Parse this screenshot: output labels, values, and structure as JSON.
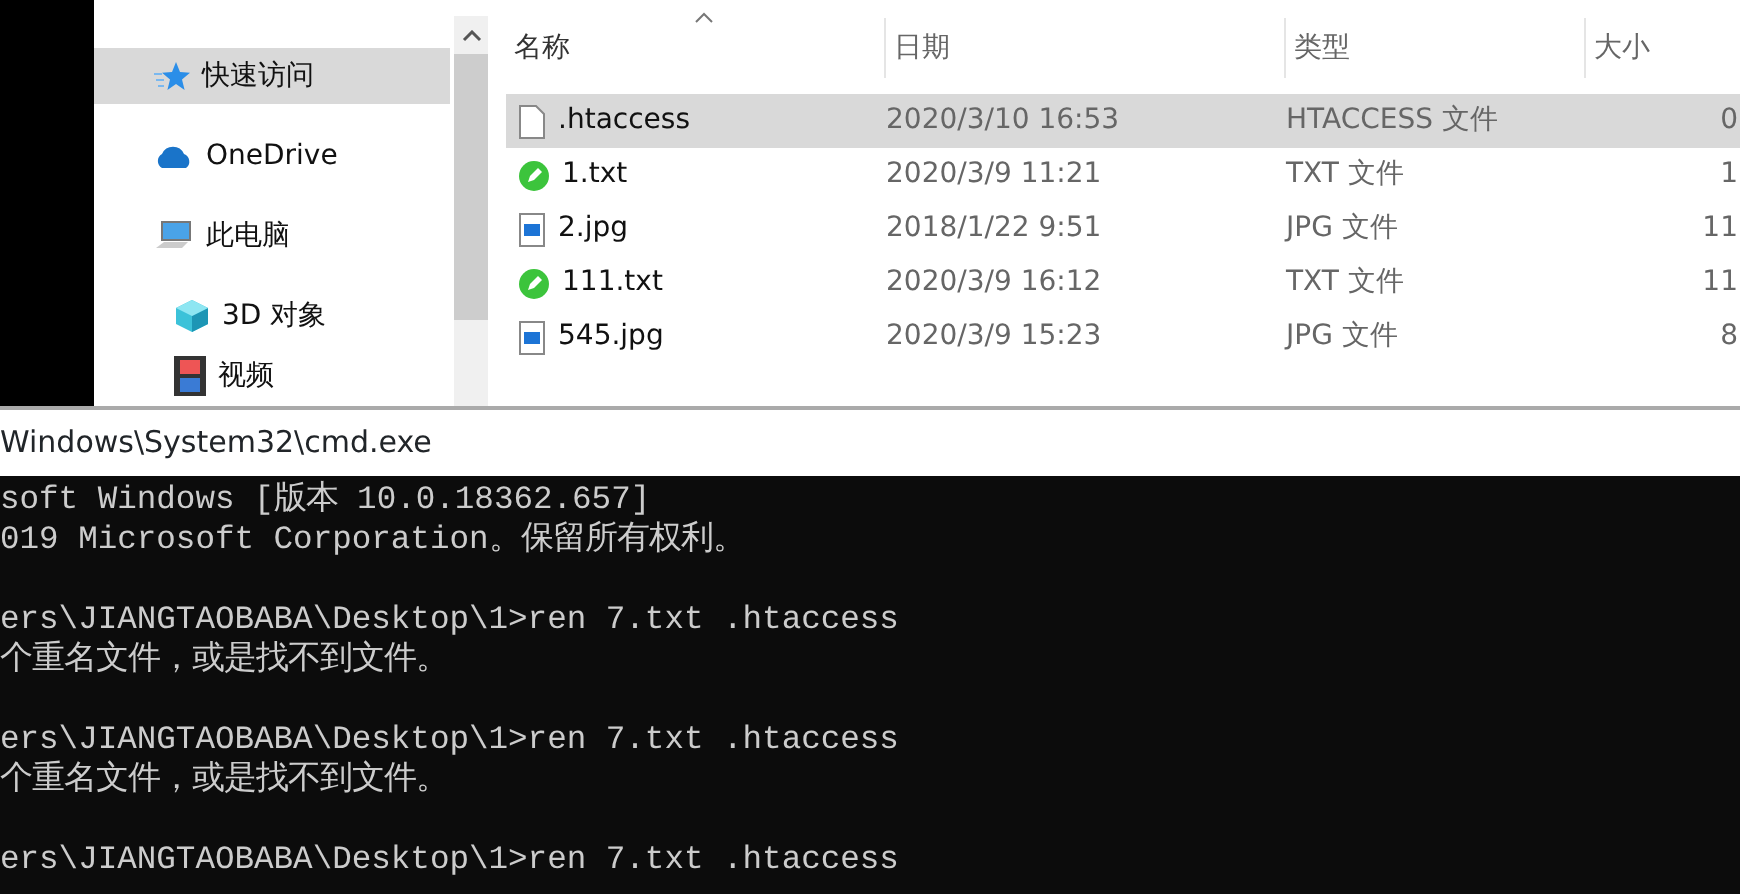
{
  "explorer": {
    "nav": [
      {
        "label": "快速访问",
        "kind": "star",
        "selected": true
      },
      {
        "label": "OneDrive",
        "kind": "cloud",
        "selected": false
      },
      {
        "label": "此电脑",
        "kind": "pc",
        "selected": false,
        "children": [
          {
            "label": "3D 对象",
            "kind": "cube",
            "selected": false
          },
          {
            "label": "视频",
            "kind": "film",
            "selected": false
          }
        ]
      }
    ],
    "columns": [
      "名称",
      "日期",
      "类型",
      "大小"
    ],
    "rows": [
      {
        "name": ".htaccess",
        "kind": "blank",
        "date": "2020/3/10 16:53",
        "type": "HTACCESS 文件",
        "size": "0",
        "selected": true
      },
      {
        "name": "1.txt",
        "kind": "txt",
        "date": "2020/3/9 11:21",
        "type": "TXT 文件",
        "size": "1",
        "selected": false
      },
      {
        "name": "2.jpg",
        "kind": "jpg",
        "date": "2018/1/22 9:51",
        "type": "JPG 文件",
        "size": "11",
        "selected": false
      },
      {
        "name": "111.txt",
        "kind": "txt",
        "date": "2020/3/9 16:12",
        "type": "TXT 文件",
        "size": "11",
        "selected": false
      },
      {
        "name": "545.jpg",
        "kind": "jpg",
        "date": "2020/3/9 15:23",
        "type": "JPG 文件",
        "size": "8",
        "selected": false
      }
    ]
  },
  "console": {
    "title": "Windows\\System32\\cmd.exe",
    "blocks": [
      [
        "soft Windows [版本 10.0.18362.657]",
        "019 Microsoft Corporation。保留所有权利。"
      ],
      [
        "ers\\JIANGTAOBABA\\Desktop\\1>ren 7.txt .htaccess",
        "个重名文件，或是找不到文件。"
      ],
      [
        "ers\\JIANGTAOBABA\\Desktop\\1>ren 7.txt .htaccess",
        "个重名文件，或是找不到文件。"
      ],
      [
        "ers\\JIANGTAOBABA\\Desktop\\1>ren 7.txt .htaccess"
      ]
    ]
  }
}
